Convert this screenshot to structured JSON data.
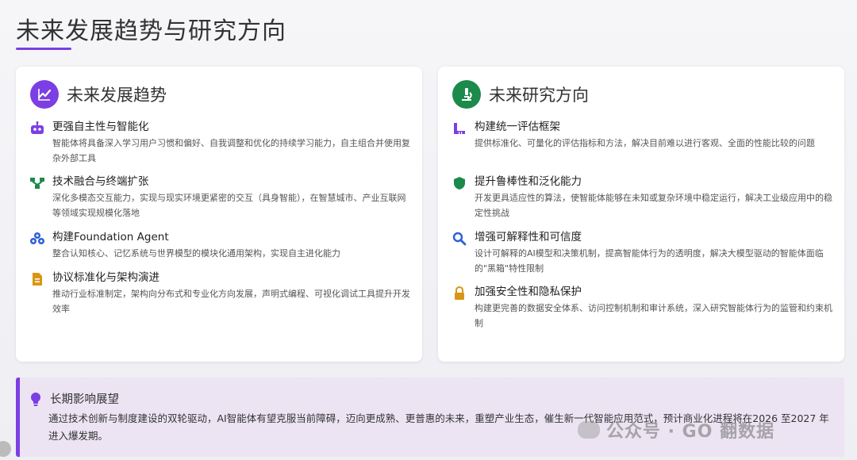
{
  "page": {
    "title": "未来发展趋势与研究方向"
  },
  "left_card": {
    "title": "未来发展趋势",
    "icon": "trending-chart-icon",
    "items": [
      {
        "icon": "robot-icon",
        "title": "更强自主性与智能化",
        "desc": "智能体将具备深入学习用户习惯和偏好、自我调整和优化的持续学习能力，自主组合并使用复杂外部工具"
      },
      {
        "icon": "network-icon",
        "title": "技术融合与终端扩张",
        "desc": "深化多模态交互能力，实现与现实环境更紧密的交互（具身智能），在智慧城市、产业互联网等领域实现规模化落地"
      },
      {
        "icon": "cubes-icon",
        "title": "构建Foundation Agent",
        "desc": "整合认知核心、记忆系统与世界模型的模块化通用架构，实现自主进化能力"
      },
      {
        "icon": "document-icon",
        "title": "协议标准化与架构演进",
        "desc": "推动行业标准制定，架构向分布式和专业化方向发展，声明式编程、可视化调试工具提升开发效率"
      }
    ]
  },
  "right_card": {
    "title": "未来研究方向",
    "icon": "microscope-icon",
    "items": [
      {
        "icon": "ruler-icon",
        "title": "构建统一评估框架",
        "desc": "提供标准化、可量化的评估指标和方法，解决目前难以进行客观、全面的性能比较的问题"
      },
      {
        "icon": "shield-icon",
        "title": "提升鲁棒性和泛化能力",
        "desc": "开发更具适应性的算法，使智能体能够在未知或复杂环境中稳定运行，解决工业级应用中的稳定性挑战"
      },
      {
        "icon": "search-icon",
        "title": "增强可解释性和可信度",
        "desc": "设计可解释的AI模型和决策机制，提高智能体行为的透明度，解决大模型驱动的智能体面临的\"黑箱\"特性限制"
      },
      {
        "icon": "lock-icon",
        "title": "加强安全性和隐私保护",
        "desc": "构建更完善的数据安全体系、访问控制机制和审计系统，深入研究智能体行为的监管和约束机制"
      }
    ]
  },
  "banner": {
    "icon": "lightbulb-icon",
    "title": "长期影响展望",
    "text": "通过技术创新与制度建设的双轮驱动，AI智能体有望克服当前障碍，迈向更成熟、更普惠的未来，重塑产业生态，催生新一代智能应用范式，预计商业化进程将在2026 至2027 年进入爆发期。"
  },
  "watermark": {
    "text": "公众号 · GO 翻数据"
  },
  "colors": {
    "accent_purple": "#7b3fe4",
    "accent_green": "#1b8a4a",
    "banner_bg": "#ece4f3"
  }
}
